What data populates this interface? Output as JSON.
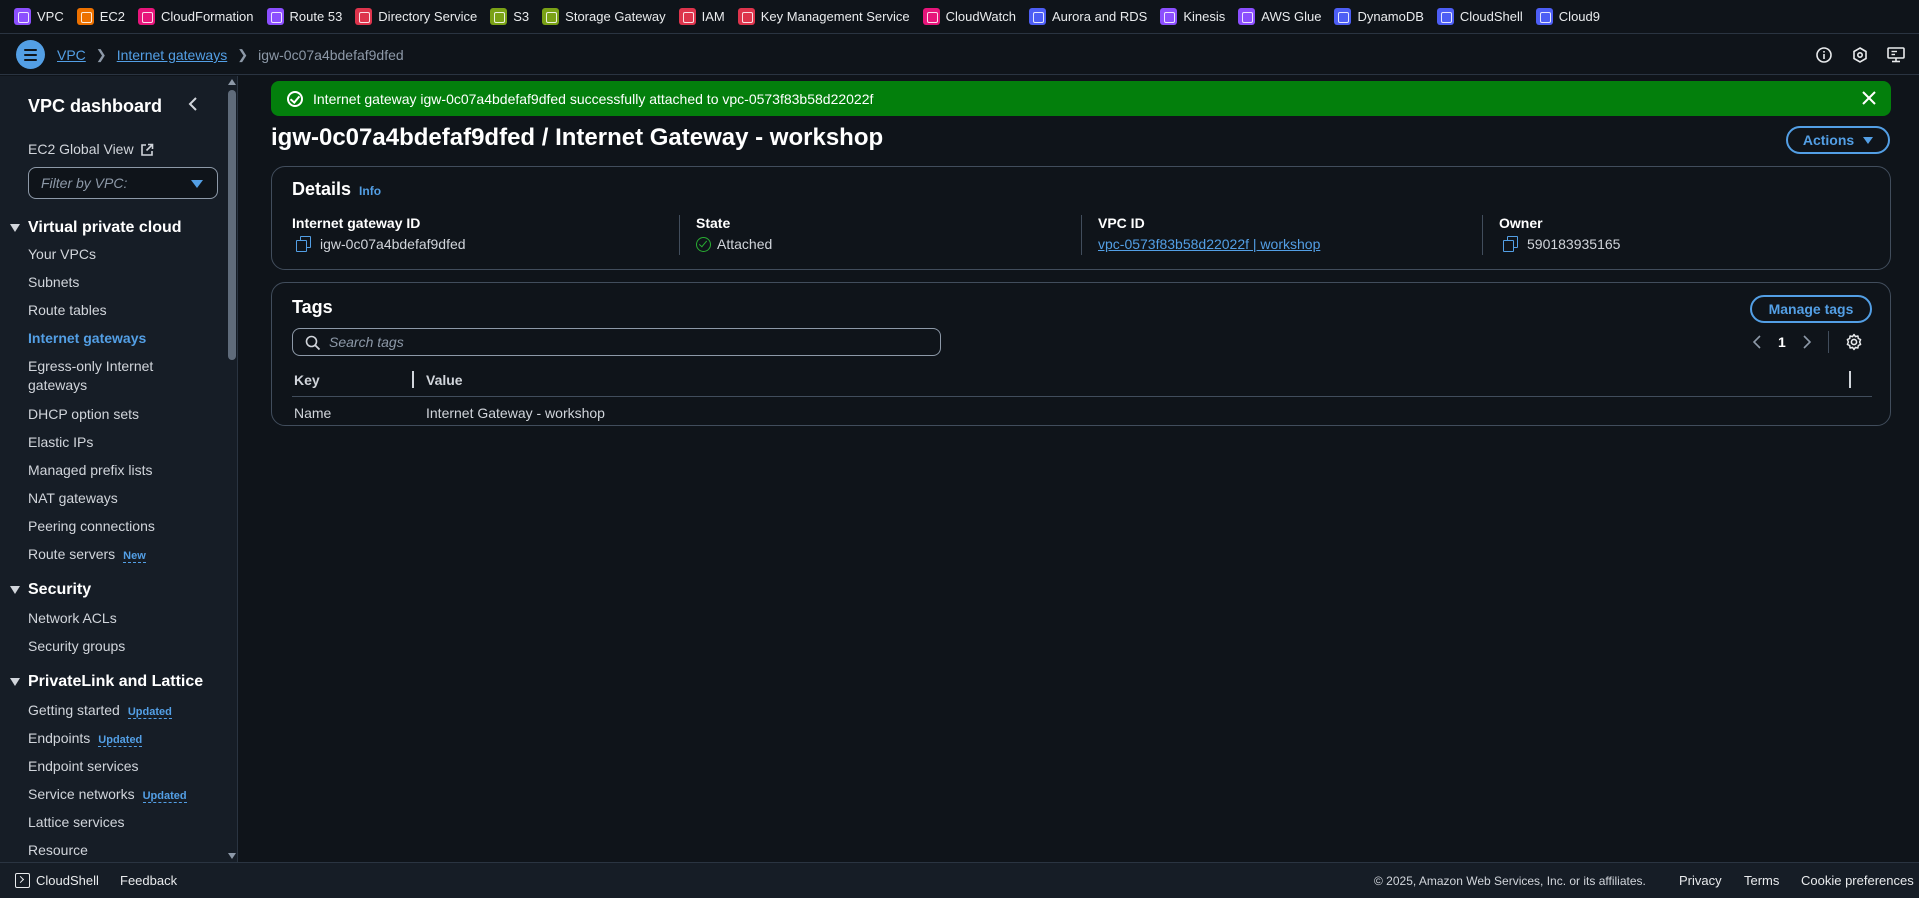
{
  "favorites": [
    {
      "label": "VPC",
      "color": "#8c4fff"
    },
    {
      "label": "EC2",
      "color": "#ed7100"
    },
    {
      "label": "CloudFormation",
      "color": "#e7157b"
    },
    {
      "label": "Route 53",
      "color": "#8c4fff"
    },
    {
      "label": "Directory Service",
      "color": "#dd344c"
    },
    {
      "label": "S3",
      "color": "#7aa116"
    },
    {
      "label": "Storage Gateway",
      "color": "#7aa116"
    },
    {
      "label": "IAM",
      "color": "#dd344c"
    },
    {
      "label": "Key Management Service",
      "color": "#dd344c"
    },
    {
      "label": "CloudWatch",
      "color": "#e7157b"
    },
    {
      "label": "Aurora and RDS",
      "color": "#4d5ef5"
    },
    {
      "label": "Kinesis",
      "color": "#8c4fff"
    },
    {
      "label": "AWS Glue",
      "color": "#8c4fff"
    },
    {
      "label": "DynamoDB",
      "color": "#4d5ef5"
    },
    {
      "label": "CloudShell",
      "color": "#4d5ef5"
    },
    {
      "label": "Cloud9",
      "color": "#4d5ef5"
    }
  ],
  "breadcrumb": {
    "root": "VPC",
    "section": "Internet gateways",
    "current": "igw-0c07a4bdefaf9dfed"
  },
  "sidebar": {
    "title": "VPC dashboard",
    "global_view": "EC2 Global View",
    "filter_placeholder": "Filter by VPC:",
    "sections": [
      {
        "label": "Virtual private cloud",
        "items": [
          {
            "label": "Your VPCs"
          },
          {
            "label": "Subnets"
          },
          {
            "label": "Route tables"
          },
          {
            "label": "Internet gateways",
            "active": true
          },
          {
            "label": "Egress-only Internet gateways"
          },
          {
            "label": "DHCP option sets"
          },
          {
            "label": "Elastic IPs"
          },
          {
            "label": "Managed prefix lists"
          },
          {
            "label": "NAT gateways"
          },
          {
            "label": "Peering connections"
          },
          {
            "label": "Route servers",
            "badge": "New"
          }
        ]
      },
      {
        "label": "Security",
        "items": [
          {
            "label": "Network ACLs"
          },
          {
            "label": "Security groups"
          }
        ]
      },
      {
        "label": "PrivateLink and Lattice",
        "items": [
          {
            "label": "Getting started",
            "badge": "Updated"
          },
          {
            "label": "Endpoints",
            "badge": "Updated"
          },
          {
            "label": "Endpoint services"
          },
          {
            "label": "Service networks",
            "badge": "Updated"
          },
          {
            "label": "Lattice services"
          },
          {
            "label": "Resource"
          }
        ]
      }
    ]
  },
  "flash": {
    "message": "Internet gateway igw-0c07a4bdefaf9dfed successfully attached to vpc-0573f83b58d22022f",
    "color": "#037f0c"
  },
  "page": {
    "title": "igw-0c07a4bdefaf9dfed / Internet Gateway - workshop",
    "actions_label": "Actions"
  },
  "details": {
    "heading": "Details",
    "info": "Info",
    "igw_id_label": "Internet gateway ID",
    "igw_id": "igw-0c07a4bdefaf9dfed",
    "state_label": "State",
    "state": "Attached",
    "vpc_id_label": "VPC ID",
    "vpc_id": "vpc-0573f83b58d22022f | workshop",
    "owner_label": "Owner",
    "owner": "590183935165"
  },
  "tags": {
    "heading": "Tags",
    "manage_label": "Manage tags",
    "search_placeholder": "Search tags",
    "page": "1",
    "columns": [
      "Key",
      "Value"
    ],
    "rows": [
      {
        "key": "Name",
        "value": "Internet Gateway - workshop"
      }
    ]
  },
  "footer": {
    "cloudshell": "CloudShell",
    "feedback": "Feedback",
    "copyright": "© 2025, Amazon Web Services, Inc. or its affiliates.",
    "privacy": "Privacy",
    "terms": "Terms",
    "cookies": "Cookie preferences"
  },
  "colors": {
    "accent": "#539fe5",
    "success": "#29ad32",
    "background": "#0f141a"
  }
}
